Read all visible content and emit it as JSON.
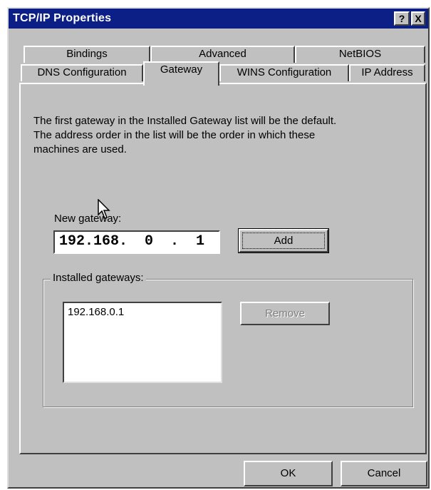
{
  "window": {
    "title": "TCP/IP Properties",
    "help_glyph": "?",
    "close_glyph": "X"
  },
  "tabs": {
    "row1": [
      "Bindings",
      "Advanced",
      "NetBIOS"
    ],
    "row2": [
      "DNS Configuration",
      "Gateway",
      "WINS Configuration",
      "IP Address"
    ],
    "active": "Gateway"
  },
  "description": {
    "line1": "The first gateway in the Installed Gateway list will be the default.",
    "line2": "The address order in the list will be the order in which these",
    "line3": "machines are used."
  },
  "new_gateway": {
    "label": "New gateway:",
    "value": "192.168.  0  .  1",
    "add_button": "Add"
  },
  "installed": {
    "label": "Installed gateways:",
    "items": [
      "192.168.0.1"
    ],
    "remove_button": "Remove"
  },
  "footer": {
    "ok": "OK",
    "cancel": "Cancel"
  }
}
